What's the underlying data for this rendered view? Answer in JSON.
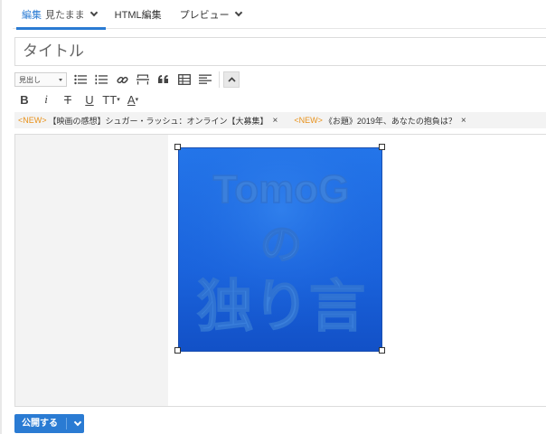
{
  "tabs": [
    {
      "label": "編集",
      "sub": "見たまま",
      "active": true
    },
    {
      "label": "HTML編集",
      "sub": "",
      "active": false
    },
    {
      "label": "プレビュー",
      "sub": "",
      "active": false
    }
  ],
  "title_input": {
    "placeholder": "タイトル",
    "value": ""
  },
  "toolbar": {
    "heading_select": "見出し",
    "icons": [
      "bulleted-list-icon",
      "numbered-list-icon",
      "link-icon",
      "horizontal-rule-icon",
      "quote-icon",
      "table-icon",
      "align-icon",
      "collapse-up-icon"
    ],
    "format": {
      "bold": "B",
      "italic": "i",
      "strike": "T",
      "underline": "U",
      "size": "TT",
      "color": "A"
    }
  },
  "notices": [
    {
      "tag": "<NEW>",
      "text": "【映画の感想】シュガー・ラッシュ：オンライン【大募集】",
      "close": "×"
    },
    {
      "tag": "<NEW>",
      "text": "《お題》2019年、あなたの抱負は？",
      "close": "×"
    }
  ],
  "image": {
    "lines": [
      "TomoG",
      "の",
      "独り言"
    ],
    "bg_top": "#1f6fe0",
    "bg_bottom": "#1452c8",
    "text_color": "#3d7fd9"
  },
  "publish": {
    "label": "公開する"
  },
  "colors": {
    "accent": "#2a7bd3",
    "notice_tag": "#e8921b"
  }
}
